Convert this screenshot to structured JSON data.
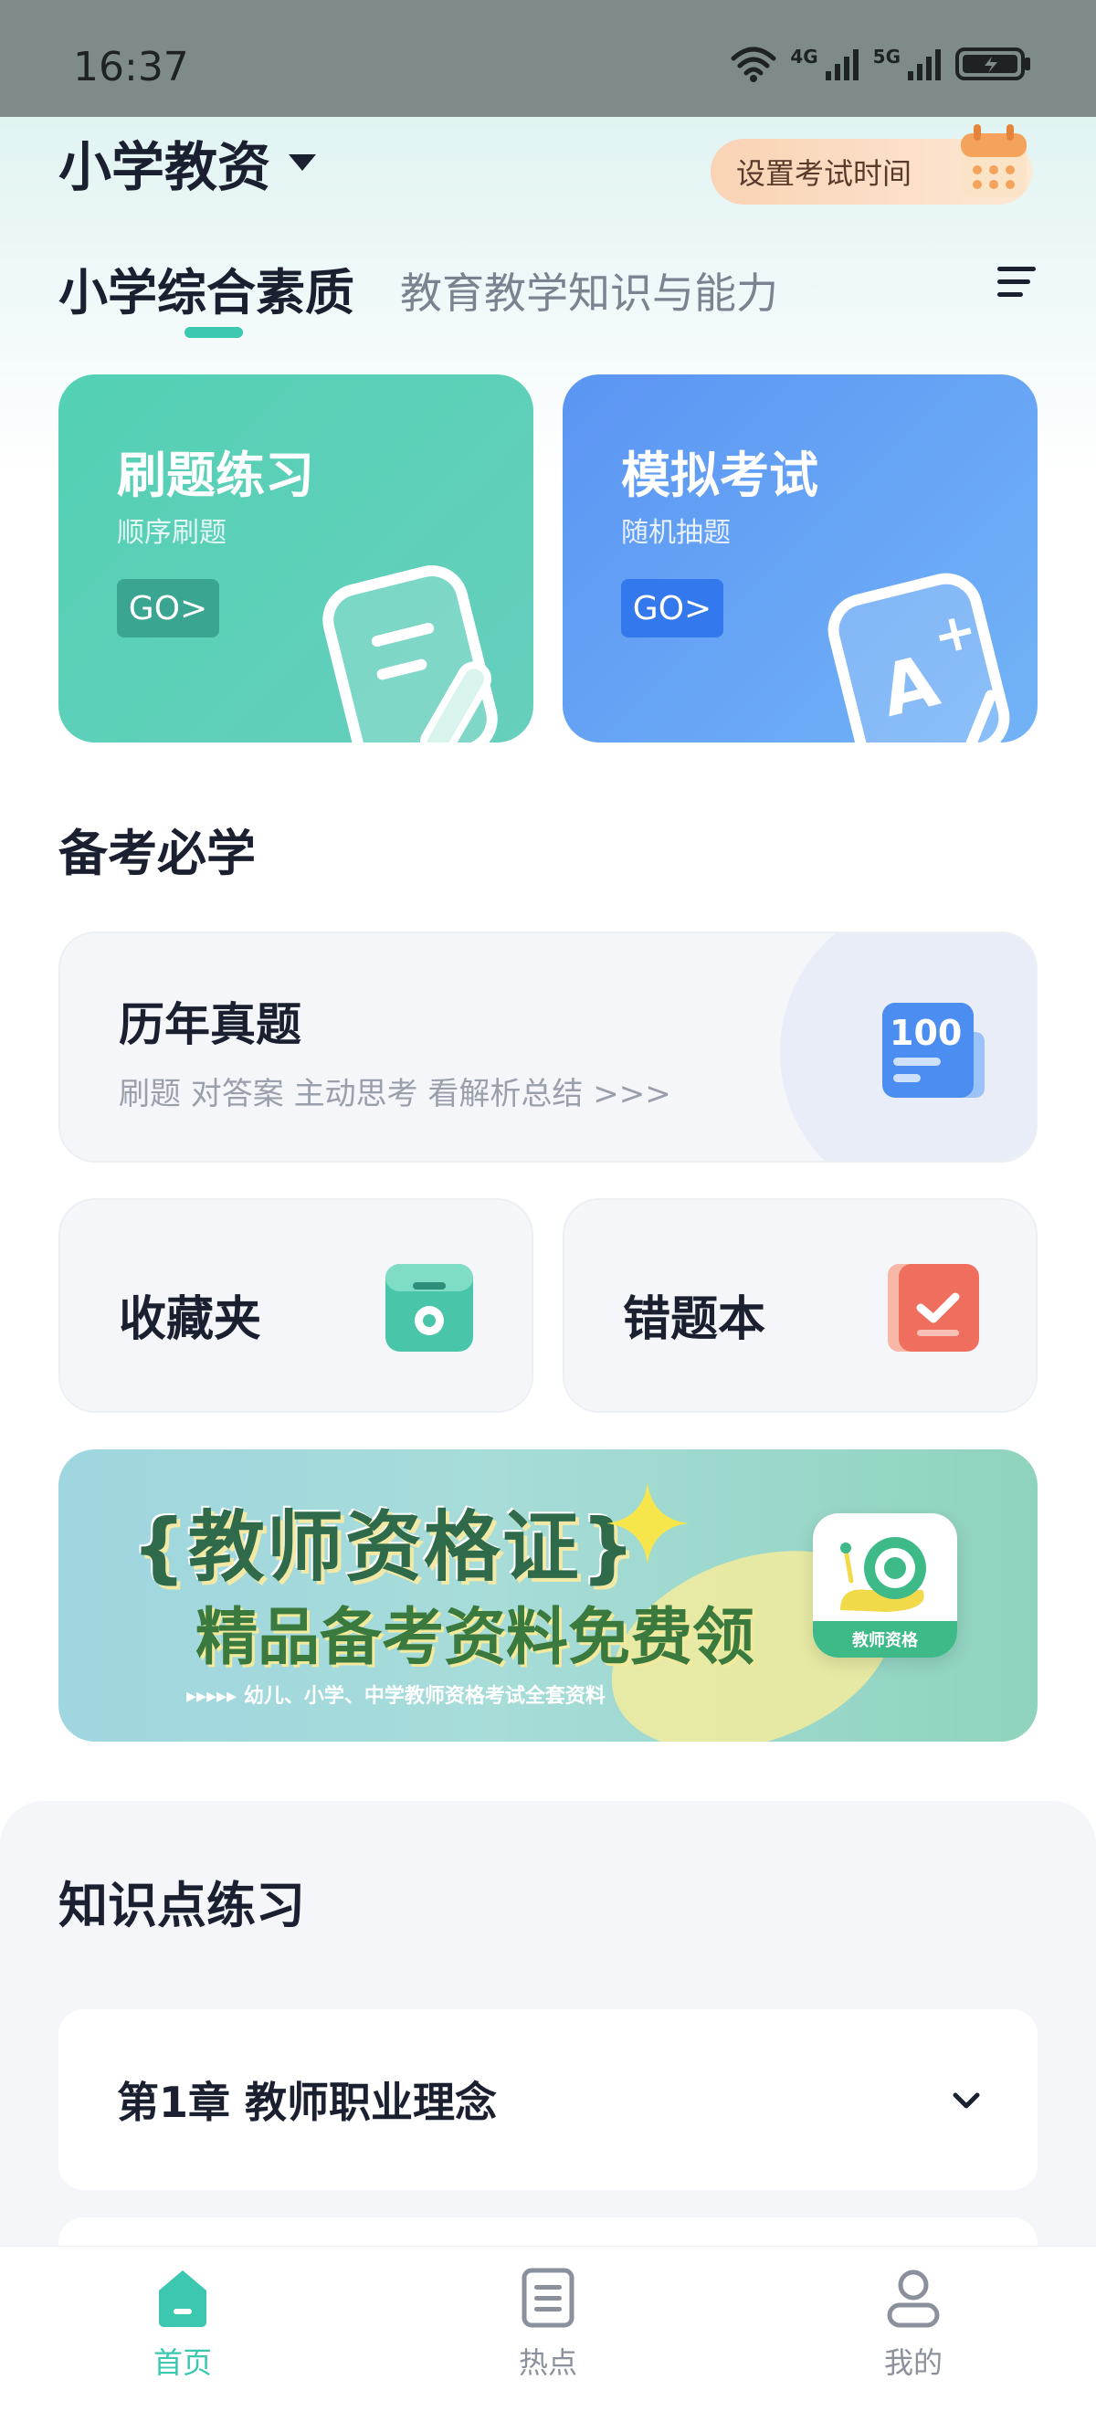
{
  "status_bar": {
    "time": "16:37",
    "net1": "4G",
    "net2": "5G"
  },
  "header": {
    "exam_type": "小学教资",
    "set_time_label": "设置考试时间"
  },
  "tabs": [
    {
      "label": "小学综合素质",
      "active": true
    },
    {
      "label": "教育教学知识与能力",
      "active": false
    }
  ],
  "cards": {
    "practice": {
      "title": "刷题练习",
      "subtitle": "顺序刷题",
      "go": "GO>"
    },
    "mock": {
      "title": "模拟考试",
      "subtitle": "随机抽题",
      "go": "GO>"
    }
  },
  "prep": {
    "section_title": "备考必学",
    "past_papers": {
      "title": "历年真题",
      "subtitle": "刷题   对答案   主动思考   看解析总结 >>>",
      "badge": "100"
    },
    "favorites": {
      "label": "收藏夹"
    },
    "wrong_book": {
      "label": "错题本"
    }
  },
  "banner": {
    "title": "{教师资格证}",
    "subtitle": "精品备考资料免费领",
    "small": "▸▸▸▸▸  幼儿、小学、中学教师资格考试全套资料",
    "logo_text": "教师资格"
  },
  "knowledge": {
    "section_title": "知识点练习",
    "chapters": [
      {
        "label": "第1章  教师职业理念"
      },
      {
        "label": ""
      }
    ]
  },
  "bottom_nav": [
    {
      "label": "首页",
      "active": true
    },
    {
      "label": "热点",
      "active": false
    },
    {
      "label": "我的",
      "active": false
    }
  ],
  "colors": {
    "accent": "#3cc7b0",
    "practice_card": "#53d0b4",
    "mock_card": "#5b95f3",
    "calendar": "#f5a35c"
  }
}
